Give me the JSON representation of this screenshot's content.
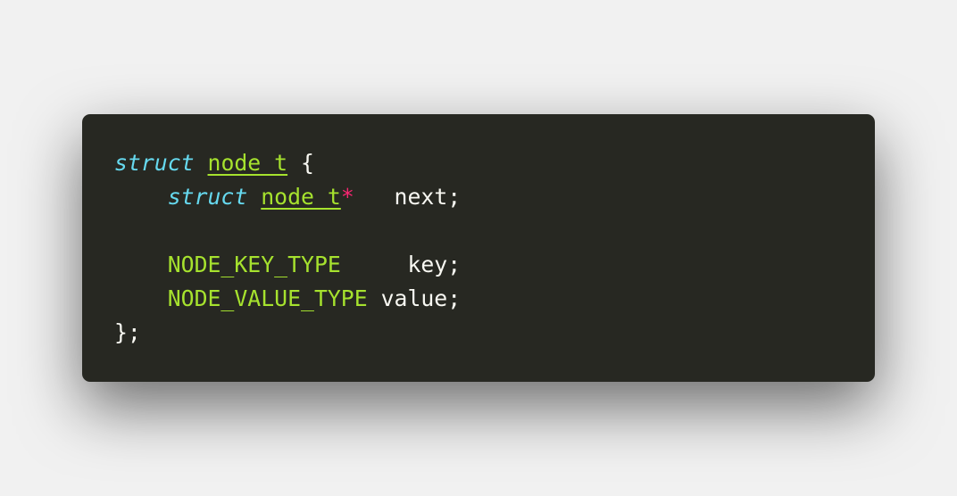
{
  "code": {
    "line1": {
      "kw": "struct",
      "type": "node_t",
      "punct": "{"
    },
    "line2": {
      "kw": "struct",
      "type": "node_t",
      "op": "*",
      "ident": "next;"
    },
    "line4": {
      "macro": "NODE_KEY_TYPE",
      "ident": "key;"
    },
    "line5": {
      "macro": "NODE_VALUE_TYPE",
      "ident": "value;"
    },
    "line6": {
      "punct": "};"
    }
  },
  "colors": {
    "background": "#f1f1f1",
    "editor_background": "#272822",
    "keyword": "#66d9ef",
    "type": "#a6e22e",
    "operator": "#f92672",
    "text": "#f8f8f2"
  }
}
